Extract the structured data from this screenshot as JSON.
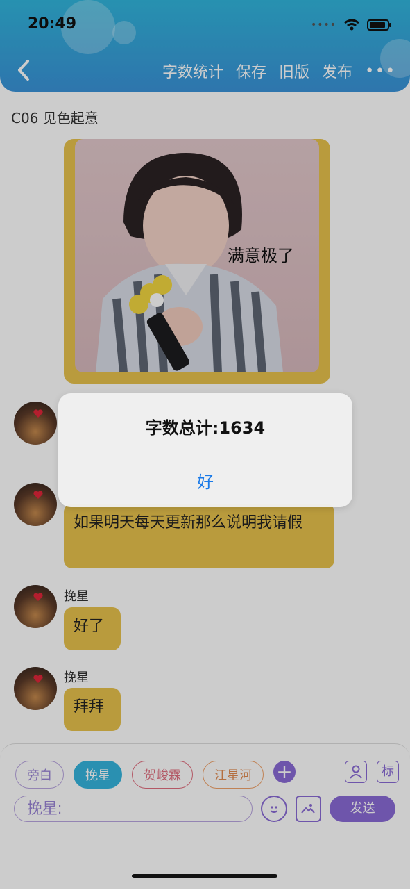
{
  "status": {
    "time": "20:49"
  },
  "nav": {
    "actions": [
      "字数统计",
      "保存",
      "旧版",
      "发布"
    ],
    "more": "•••"
  },
  "chapter": {
    "title": "C06 见色起意"
  },
  "sticker": {
    "caption": "满意极了"
  },
  "messages": [
    {
      "name": "",
      "text": "如果明天每天更新那么说明我请假"
    },
    {
      "name": "挽星",
      "text": "好了"
    },
    {
      "name": "挽星",
      "text": "拜拜"
    }
  ],
  "characters": [
    {
      "label": "旁白",
      "selected": false
    },
    {
      "label": "挽星",
      "selected": true
    },
    {
      "label": "贺峻霖",
      "selected": false
    },
    {
      "label": "江星河",
      "selected": false
    }
  ],
  "input": {
    "placeholder": "挽星:"
  },
  "send_label": "发送",
  "tag_label": "标",
  "alert": {
    "title": "字数总计:1634",
    "ok": "好"
  },
  "colors": {
    "accent_blue": "#35b5de",
    "purple": "#8a6bd6",
    "bubble_gold": "#e8c24d"
  }
}
